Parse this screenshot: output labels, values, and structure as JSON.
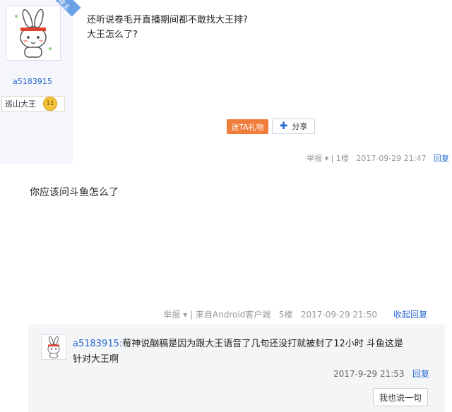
{
  "post1": {
    "corner_tag": "楼主",
    "username": "a5183915",
    "badge_title": "巡山大王",
    "level": "11",
    "body_line1": "还听说卷毛开直播期间都不敢找大王排?",
    "body_line2": "大王怎么了?",
    "gift_button": "送TA礼物",
    "share_button": "分享",
    "report": "举报",
    "floor": "1楼",
    "time": "2017-09-29 21:47",
    "reply_link": "回复"
  },
  "post2": {
    "body": "你应该问斗鱼怎么了",
    "report": "举报",
    "client": "来自Android客户端",
    "floor": "5楼",
    "time": "2017-09-29 21:50",
    "reply_link": "收起回复"
  },
  "reply": {
    "username": "a5183915:",
    "text_line1": "莓神说酗稿是因为跟大王语音了几句还没打就被封了12小时 斗鱼这是",
    "text_line2": "针对大王啊",
    "time": "2017-9-29 21:53",
    "reply_link": "回复",
    "say_button": "我也说一句"
  },
  "colors": {
    "link": "#2a6ad0",
    "gift": "#f07c3a"
  },
  "icons": {
    "avatar": "rabbit-avatar-icon",
    "share": "plus-icon",
    "report_dropdown": "chevron-down-icon"
  }
}
